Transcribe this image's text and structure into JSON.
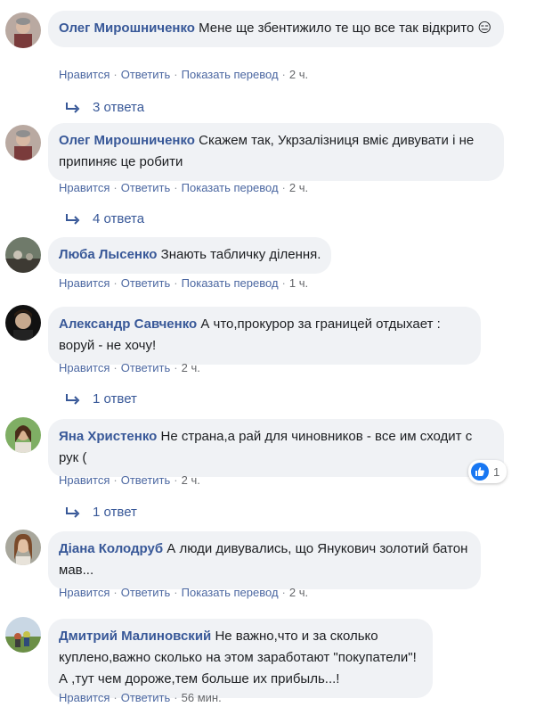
{
  "actions": {
    "like": "Нравится",
    "reply": "Ответить",
    "translate": "Показать перевод",
    "separator": "·"
  },
  "comments": [
    {
      "author": "Олег Мирошниченко",
      "text": "Мене ще збентижило те що все так відкрито 😑",
      "time": "2 ч.",
      "has_translate": true,
      "replies": "3 ответа"
    },
    {
      "author": "Олег Мирошниченко",
      "text": "Скажем так, Укрзалізниця вміє дивувати і не припиняє це робити",
      "time": "2 ч.",
      "has_translate": true,
      "replies": "4 ответа"
    },
    {
      "author": "Люба Лысенко",
      "text": "Знають табличку ділення.",
      "time": "1 ч.",
      "has_translate": true,
      "replies": ""
    },
    {
      "author": "Александр Савченко",
      "text": "А что,прокурор за границей отдыхает : воруй - не хочу!",
      "time": "2 ч.",
      "has_translate": false,
      "replies": "1 ответ"
    },
    {
      "author": "Яна Христенко",
      "text": "Не страна,а рай для чиновников - все им сходит с рук (",
      "time": "2 ч.",
      "has_translate": false,
      "replies": "1 ответ",
      "reaction_count": "1"
    },
    {
      "author": "Діана Колодруб",
      "text": "А люди дивувались, що Янукович золотий батон мав...",
      "time": "2 ч.",
      "has_translate": true,
      "replies": ""
    },
    {
      "author": "Дмитрий Малиновский",
      "text": "Не важно,что и за сколько куплено,важно сколько на этом заработают \"покупатели\"! А ,тут чем дороже,тем больше их прибыль...!",
      "time": "56 мин.",
      "has_translate": false,
      "replies": ""
    }
  ]
}
